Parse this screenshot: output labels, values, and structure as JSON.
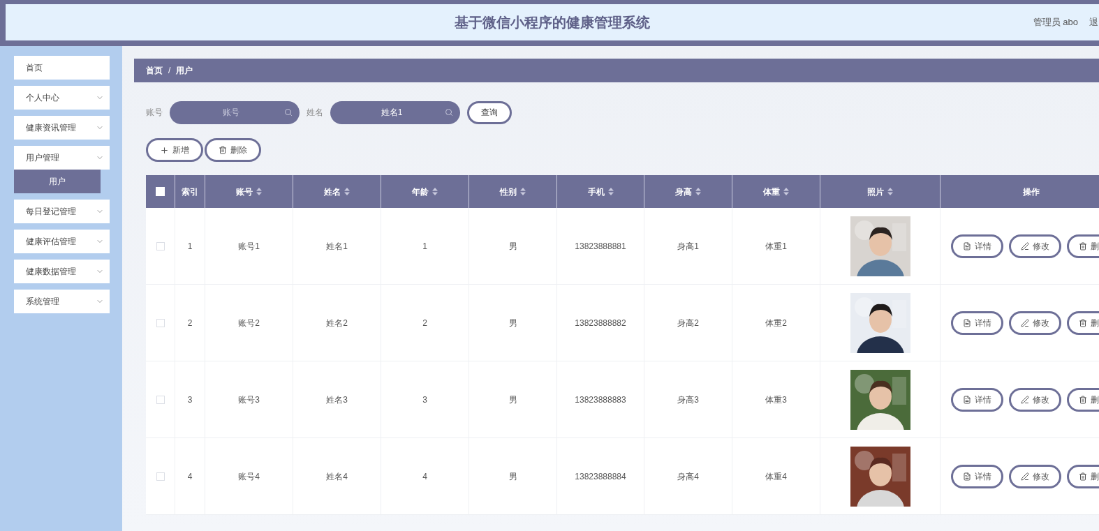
{
  "header": {
    "title": "基于微信小程序的健康管理系统",
    "user": "管理员 abo",
    "logout": "退"
  },
  "sidebar": {
    "items": [
      {
        "label": "首页",
        "expandable": false
      },
      {
        "label": "个人中心",
        "expandable": true
      },
      {
        "label": "健康资讯管理",
        "expandable": true
      },
      {
        "label": "用户管理",
        "expandable": true,
        "children": [
          {
            "label": "用户",
            "selected": true
          }
        ]
      },
      {
        "label": "每日登记管理",
        "expandable": true
      },
      {
        "label": "健康评估管理",
        "expandable": true
      },
      {
        "label": "健康数据管理",
        "expandable": true
      },
      {
        "label": "系统管理",
        "expandable": true
      }
    ]
  },
  "breadcrumb": {
    "items": [
      "首页",
      "用户"
    ],
    "separator": "/"
  },
  "search": {
    "fields": [
      {
        "label": "账号",
        "placeholder": "账号"
      },
      {
        "label": "姓名",
        "value": "姓名1"
      }
    ],
    "button": "查询"
  },
  "actions": [
    {
      "kind": "add",
      "label": "新增"
    },
    {
      "kind": "delete",
      "label": "删除"
    }
  ],
  "table": {
    "all_checked": false,
    "columns": [
      {
        "label": "索引",
        "sortable": false
      },
      {
        "label": "账号",
        "sortable": true
      },
      {
        "label": "姓名",
        "sortable": true
      },
      {
        "label": "年龄",
        "sortable": true
      },
      {
        "label": "性别",
        "sortable": true
      },
      {
        "label": "手机",
        "sortable": true
      },
      {
        "label": "身高",
        "sortable": true
      },
      {
        "label": "体重",
        "sortable": true
      },
      {
        "label": "照片",
        "sortable": true
      },
      {
        "label": "操作",
        "sortable": false
      }
    ],
    "rows": [
      {
        "checked": false,
        "cells": [
          "1",
          "账号1",
          "姓名1",
          "1",
          "男",
          "13823888881",
          "身高1",
          "体重1"
        ],
        "photo": {
          "kind": "picture"
        },
        "actions": [
          {
            "kind": "detail",
            "label": "详情"
          },
          {
            "kind": "edit",
            "label": "修改"
          },
          {
            "kind": "delete",
            "label": "删"
          }
        ]
      },
      {
        "checked": false,
        "cells": [
          "2",
          "账号2",
          "姓名2",
          "2",
          "男",
          "13823888882",
          "身高2",
          "体重2"
        ],
        "photo": {
          "kind": "picture"
        },
        "actions": [
          {
            "kind": "detail",
            "label": "详情"
          },
          {
            "kind": "edit",
            "label": "修改"
          },
          {
            "kind": "delete",
            "label": "删"
          }
        ]
      },
      {
        "checked": false,
        "cells": [
          "3",
          "账号3",
          "姓名3",
          "3",
          "男",
          "13823888883",
          "身高3",
          "体重3"
        ],
        "photo": {
          "kind": "picture"
        },
        "actions": [
          {
            "kind": "detail",
            "label": "详情"
          },
          {
            "kind": "edit",
            "label": "修改"
          },
          {
            "kind": "delete",
            "label": "删"
          }
        ]
      },
      {
        "checked": false,
        "cells": [
          "4",
          "账号4",
          "姓名4",
          "4",
          "男",
          "13823888884",
          "身高4",
          "体重4"
        ],
        "photo": {
          "kind": "picture"
        },
        "actions": [
          {
            "kind": "detail",
            "label": "详情"
          },
          {
            "kind": "edit",
            "label": "修改"
          },
          {
            "kind": "delete",
            "label": "删"
          }
        ]
      }
    ]
  }
}
